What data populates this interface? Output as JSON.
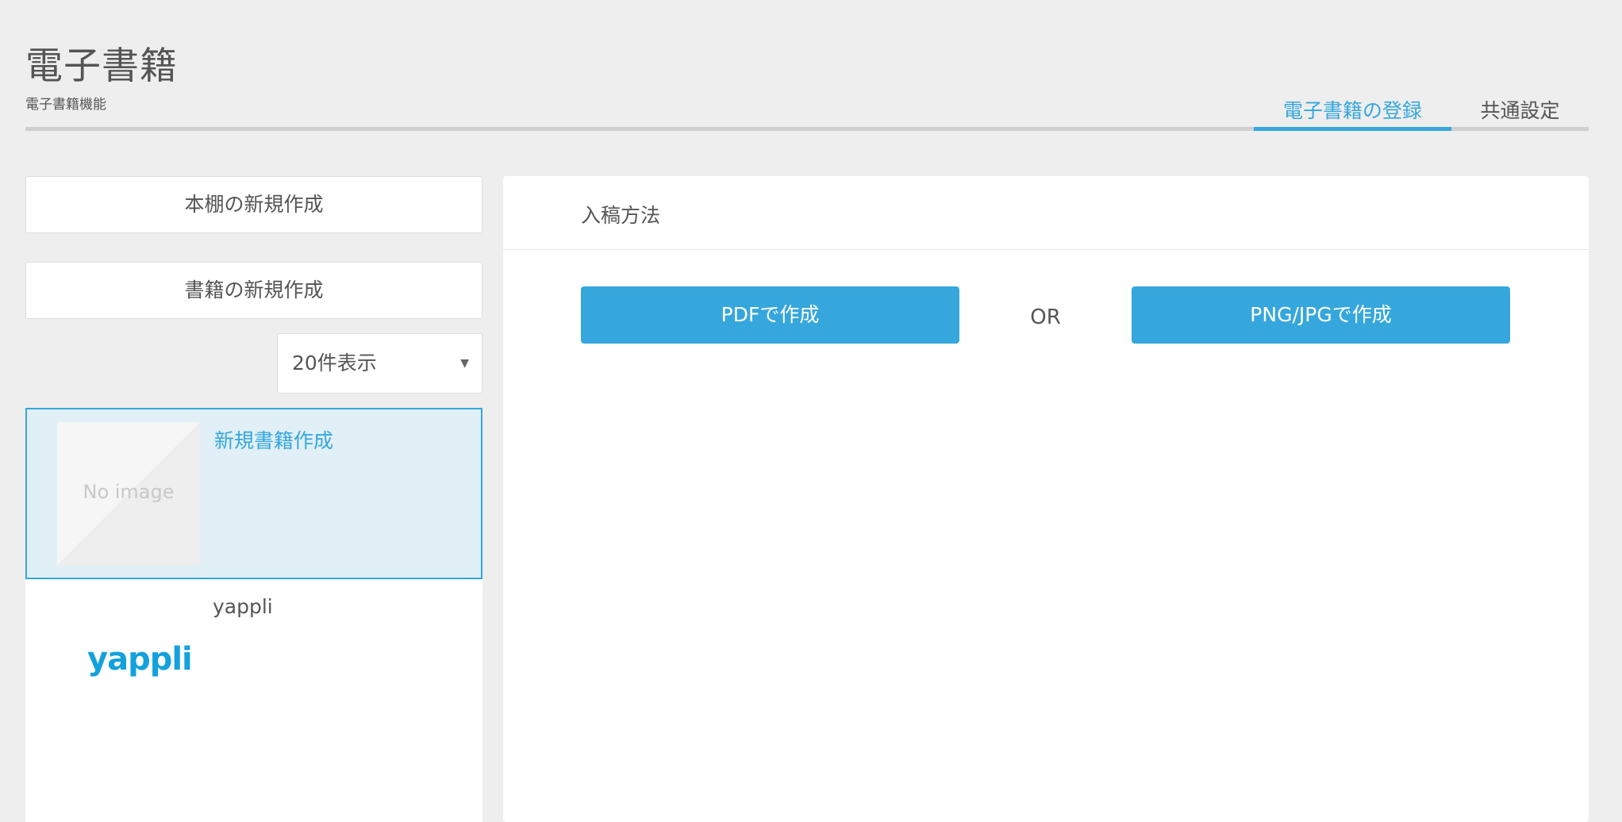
{
  "header": {
    "title": "電子書籍",
    "subtitle": "電子書籍機能",
    "tabs": [
      {
        "label": "電子書籍の登録",
        "active": true
      },
      {
        "label": "共通設定",
        "active": false
      }
    ]
  },
  "sidebar": {
    "new_shelf_label": "本棚の新規作成",
    "new_book_label": "書籍の新規作成",
    "page_size_select": {
      "selected": "20件表示"
    },
    "items": [
      {
        "title": "新規書籍作成",
        "thumbnail": "No image",
        "selected": true
      },
      {
        "title": "yappli",
        "thumbnail_logo": "yappli",
        "selected": false
      }
    ]
  },
  "panel": {
    "heading": "入稿方法",
    "pdf_button_label": "PDFで作成",
    "or_label": "OR",
    "image_button_label": "PNG/JPGで作成"
  },
  "colors": {
    "accent": "#35a7dc",
    "background": "#eeeeee",
    "selected_bg": "#e1eff6",
    "text": "#555555"
  }
}
